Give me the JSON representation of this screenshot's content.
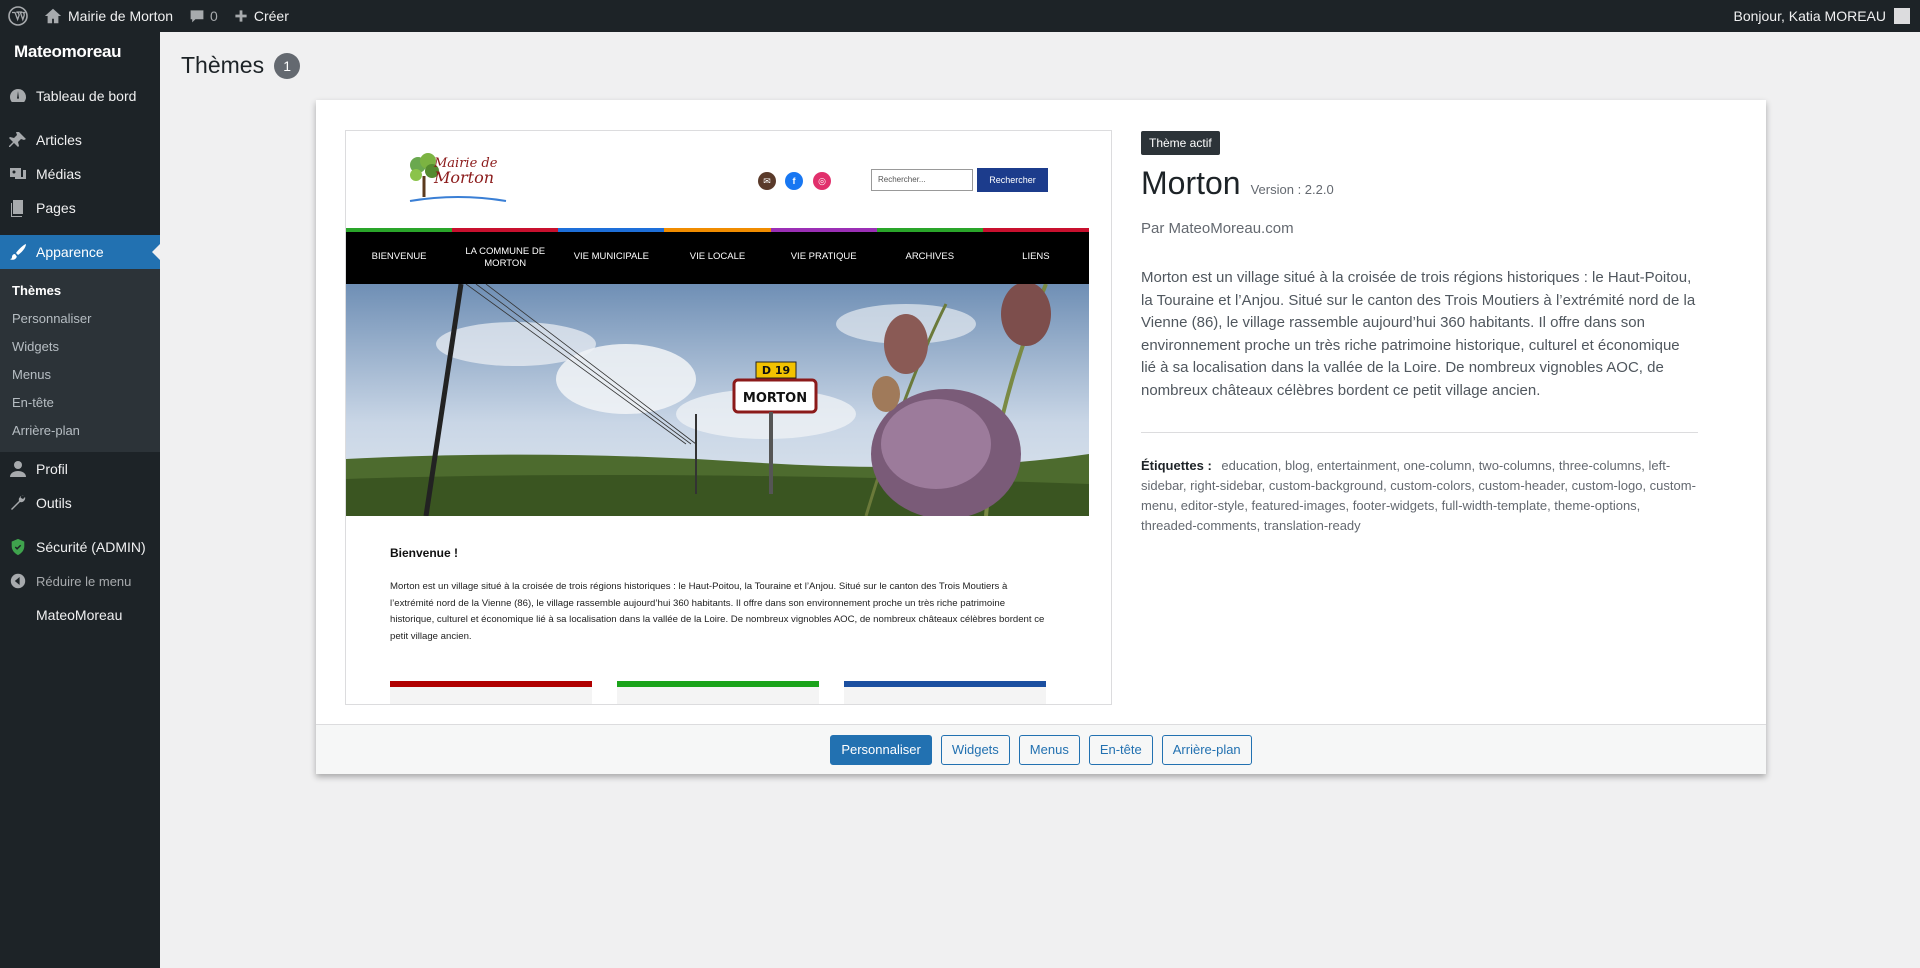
{
  "adminbar": {
    "site_name": "Mairie de Morton",
    "comments_count": "0",
    "new_label": "Créer",
    "greeting": "Bonjour, Katia MOREAU"
  },
  "sidebar": {
    "brand": "Mateomoreau",
    "items": [
      {
        "label": "Tableau de bord",
        "icon": "dashboard-icon"
      },
      {
        "label": "Articles",
        "icon": "pushpin-icon"
      },
      {
        "label": "Médias",
        "icon": "media-icon"
      },
      {
        "label": "Pages",
        "icon": "pages-icon"
      },
      {
        "label": "Apparence",
        "icon": "paintbrush-icon"
      }
    ],
    "submenu": [
      "Thèmes",
      "Personnaliser",
      "Widgets",
      "Menus",
      "En-tête",
      "Arrière-plan"
    ],
    "items2": [
      {
        "label": "Profil",
        "icon": "user-icon"
      },
      {
        "label": "Outils",
        "icon": "wrench-icon"
      },
      {
        "label": "Sécurité (ADMIN)",
        "icon": "shield-icon"
      }
    ],
    "collapse_label": "Réduire le menu",
    "footer_label": "MateoMoreau"
  },
  "page": {
    "title": "Thèmes",
    "count": "1"
  },
  "theme": {
    "badge": "Thème actif",
    "name": "Morton",
    "version": "Version : 2.2.0",
    "author": "Par MateoMoreau.com",
    "description": "Morton est un village situé à la croisée de trois régions historiques : le Haut-Poitou, la Touraine et l’Anjou. Situé sur le canton des Trois Moutiers à l’extrémité nord de la Vienne (86), le village rassemble aujourd’hui 360 habitants. Il offre dans son environnement proche un très riche patrimoine historique, culturel et économique lié à sa localisation dans la vallée de la Loire. De nombreux vignobles AOC, de nombreux châteaux célèbres bordent ce petit village ancien.",
    "tags_label": "Étiquettes :",
    "tags": "education, blog, entertainment, one-column, two-columns, three-columns, left-sidebar, right-sidebar, custom-background, custom-colors, custom-header, custom-logo, custom-menu, editor-style, featured-images, footer-widgets, full-width-template, theme-options, threaded-comments, translation-ready"
  },
  "actions": [
    "Personnaliser",
    "Widgets",
    "Menus",
    "En-tête",
    "Arrière-plan"
  ],
  "screenshot": {
    "logo_line1": "Mairie de",
    "logo_line2": "Morton",
    "search_placeholder": "Rechercher...",
    "search_button": "Rechercher",
    "nav": [
      {
        "label": "BIENVENUE",
        "color": "#2aa52a"
      },
      {
        "label": "LA COMMUNE DE MORTON",
        "color": "#c8102e"
      },
      {
        "label": "VIE MUNICIPALE",
        "color": "#1e6fd9"
      },
      {
        "label": "VIE LOCALE",
        "color": "#f08c00"
      },
      {
        "label": "VIE PRATIQUE",
        "color": "#9b2fb5"
      },
      {
        "label": "ARCHIVES",
        "color": "#2aa52a"
      },
      {
        "label": "LIENS",
        "color": "#c8102e"
      }
    ],
    "sign_top": "D 19",
    "sign_bottom": "MORTON",
    "body_title": "Bienvenue !",
    "body_text": "Morton est un village situé à la croisée de trois régions historiques : le Haut-Poitou, la Touraine et l’Anjou. Situé sur le canton des Trois Moutiers à l’extrémité nord de la Vienne (86), le village rassemble aujourd’hui 360 habitants. Il offre dans son environnement proche un très riche patrimoine historique, culturel et économique lié à sa localisation dans la vallée de la Loire. De nombreux vignobles AOC, de nombreux châteaux célèbres bordent ce petit village ancien.",
    "card_colors": [
      "#b00000",
      "#1aa31a",
      "#1b4fa0"
    ]
  },
  "colors": {
    "admin_dark": "#1d2327",
    "accent": "#2271b1"
  }
}
